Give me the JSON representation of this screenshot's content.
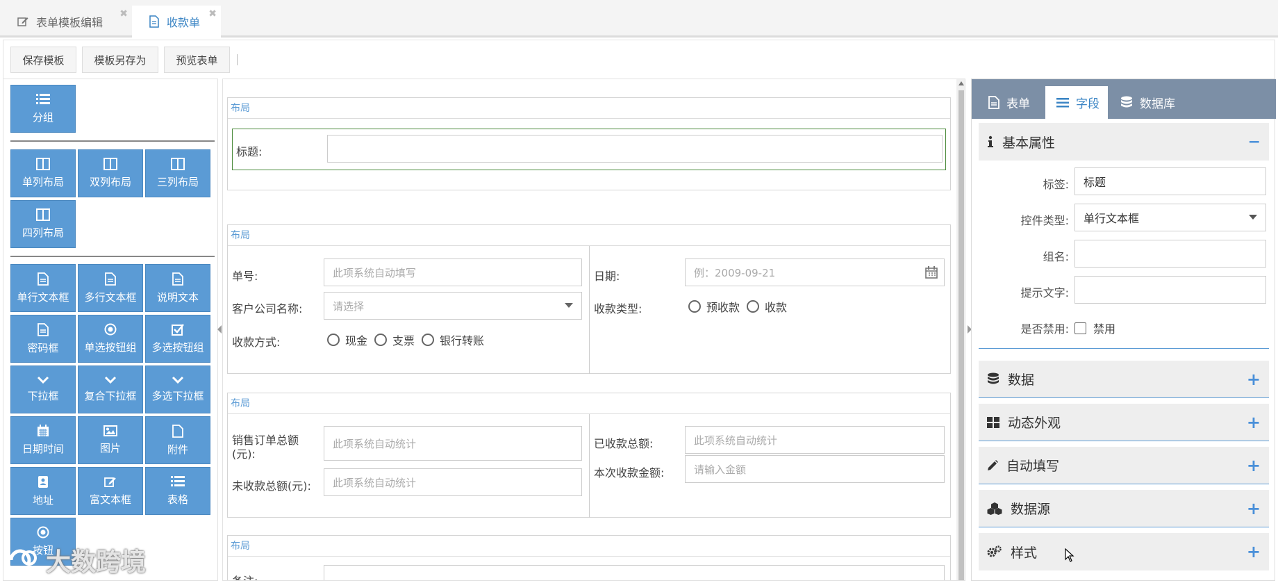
{
  "tabs": [
    {
      "label": "表单模板编辑",
      "icon": "edit-icon"
    },
    {
      "label": "收款单",
      "icon": "file-icon"
    }
  ],
  "toolbar": {
    "save": "保存模板",
    "save_as": "模板另存为",
    "preview": "预览表单"
  },
  "palette": {
    "group": "分组",
    "layouts": [
      "单列布局",
      "双列布局",
      "三列布局",
      "四列布局"
    ],
    "controls": [
      "单行文本框",
      "多行文本框",
      "说明文本",
      "密码框",
      "单选按钮组",
      "多选按钮组",
      "下拉框",
      "复合下拉框",
      "多选下拉框",
      "日期时间",
      "图片",
      "附件",
      "地址",
      "富文本框",
      "表格"
    ],
    "extra": "按钮"
  },
  "watermark": "大数跨境",
  "form": {
    "section_title": "布局",
    "title_label": "标题:",
    "order_no_label": "单号:",
    "order_no_placeholder": "此项系统自动填写",
    "date_label": "日期:",
    "date_placeholder": "例：2009-09-21",
    "customer_label": "客户公司名称:",
    "customer_placeholder": "请选择",
    "type_label": "收款类型:",
    "type_options": [
      "预收款",
      "收款"
    ],
    "method_label": "收款方式:",
    "method_options": [
      "现金",
      "支票",
      "银行转账"
    ],
    "sales_total_label": "销售订单总额(元):",
    "received_total_label": "已收款总额:",
    "unpaid_total_label": "未收款总额(元):",
    "current_amount_label": "本次收款金额:",
    "auto_stat_placeholder": "此项系统自动统计",
    "amount_placeholder": "请输入金额",
    "remark_label": "备注:"
  },
  "right_tabs": [
    {
      "label": "表单",
      "icon": "file-icon"
    },
    {
      "label": "字段",
      "icon": "list-icon"
    },
    {
      "label": "数据库",
      "icon": "database-icon"
    }
  ],
  "properties": {
    "header": "基本属性",
    "label_label": "标签:",
    "label_value": "标题",
    "control_label": "控件类型:",
    "control_value": "单行文本框",
    "group_label": "组名:",
    "hint_label": "提示文字:",
    "disabled_label": "是否禁用:",
    "disabled_option": "禁用"
  },
  "panels": [
    "数据",
    "动态外观",
    "自动填写",
    "数据源",
    "样式"
  ]
}
